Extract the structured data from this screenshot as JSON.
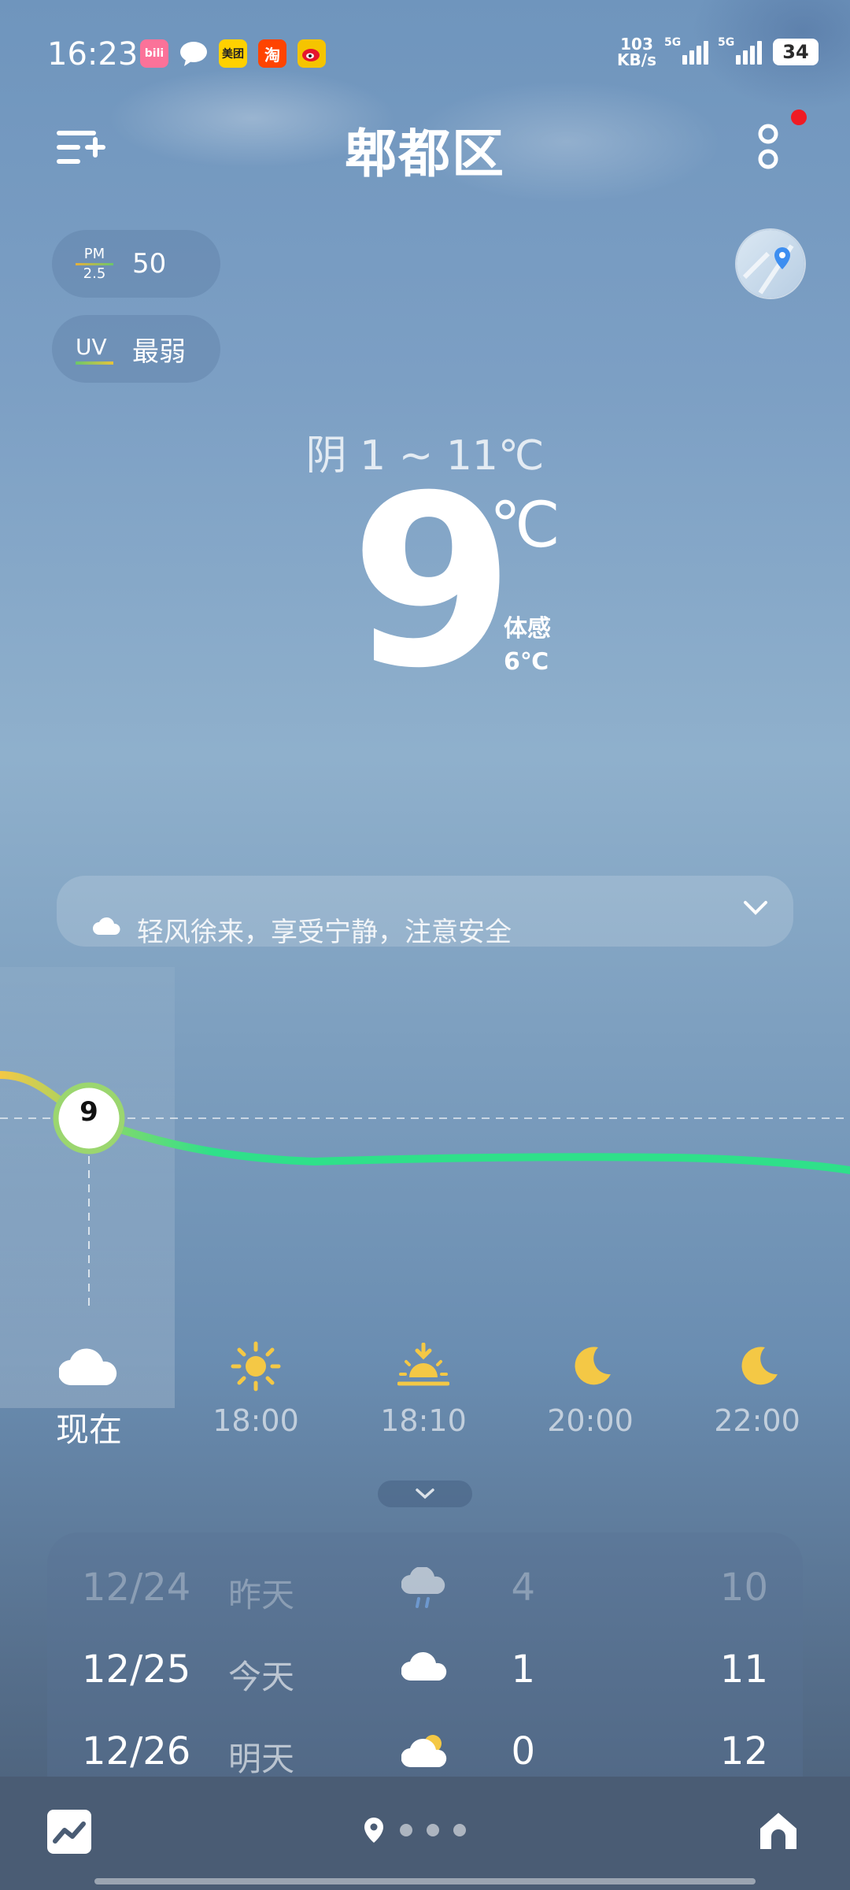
{
  "status_bar": {
    "time": "16:23",
    "net_speed_value": "103",
    "net_speed_unit": "KB/s",
    "sim1_label": "5G",
    "sim2_label": "5G",
    "battery": "34",
    "app_icons": [
      {
        "name": "bilibili",
        "text": "bili",
        "color": "#fb7299"
      },
      {
        "name": "message",
        "text": "",
        "color": "#ffffff"
      },
      {
        "name": "meituan",
        "text": "美团",
        "color": "#ffd100"
      },
      {
        "name": "taobao",
        "text": "淘",
        "color": "#ff4400"
      },
      {
        "name": "weibo",
        "text": "",
        "color": "#f5c400"
      }
    ]
  },
  "header": {
    "title": "郫都区"
  },
  "chips": {
    "pm_top": "PM",
    "pm_bottom": "2.5",
    "pm_value": "50",
    "uv_label": "UV",
    "uv_value": "最弱"
  },
  "current": {
    "condition": "阴  1 ~ 11℃",
    "temp": "9",
    "unit": "℃",
    "feels_label": "体感",
    "feels_value": "6℃"
  },
  "tip": {
    "text": "轻风徐来，享受宁静，注意安全"
  },
  "hourly": {
    "now_temp": "9",
    "items": [
      {
        "time": "现在",
        "icon": "cloud-icon"
      },
      {
        "time": "18:00",
        "icon": "sun-icon"
      },
      {
        "time": "18:10",
        "icon": "sunset-icon"
      },
      {
        "time": "20:00",
        "icon": "moon-icon"
      },
      {
        "time": "22:00",
        "icon": "moon-icon"
      }
    ]
  },
  "daily": [
    {
      "date": "12/24",
      "label": "昨天",
      "icon": "rain-icon",
      "low": "4",
      "high": "10"
    },
    {
      "date": "12/25",
      "label": "今天",
      "icon": "cloud-icon",
      "low": "1",
      "high": "11"
    },
    {
      "date": "12/26",
      "label": "明天",
      "icon": "partly-cloudy-icon",
      "low": "0",
      "high": "12"
    }
  ],
  "colors": {
    "accent_green": "#2fe08a",
    "accent_yellow": "#f4c845",
    "alert_red": "#f01b24"
  }
}
